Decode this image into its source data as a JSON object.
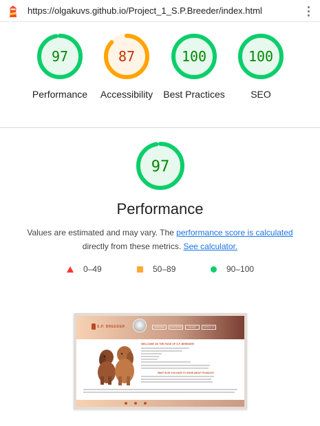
{
  "url_bar": {
    "url": "https://olgakuvs.github.io/Project_1_S.P.Breeder/index.html",
    "logo_icon": "lighthouse-icon",
    "menu_icon": "kebab-menu-icon"
  },
  "gauges": [
    {
      "label": "Performance",
      "score": "97",
      "fraction": 0.97,
      "color": "#0cce6b",
      "fill": "#e7f8ee",
      "text_color": "#008800"
    },
    {
      "label": "Accessibility",
      "score": "87",
      "fraction": 0.87,
      "color": "#ffa400",
      "fill": "#fff4e5",
      "text_color": "#c33300"
    },
    {
      "label": "Best Practices",
      "score": "100",
      "fraction": 1.0,
      "color": "#0cce6b",
      "fill": "#e7f8ee",
      "text_color": "#008800"
    },
    {
      "label": "SEO",
      "score": "100",
      "fraction": 1.0,
      "color": "#0cce6b",
      "fill": "#e7f8ee",
      "text_color": "#008800"
    }
  ],
  "performance": {
    "score": "97",
    "fraction": 0.97,
    "title": "Performance",
    "desc_prefix": "Values are estimated and may vary. The ",
    "link_score": "performance score is calculated",
    "desc_middle": " directly from these metrics. ",
    "link_calc": "See calculator."
  },
  "legend": [
    {
      "icon": "fail-triangle-icon",
      "range": "0–49",
      "color": "#ff3333"
    },
    {
      "icon": "average-square-icon",
      "range": "50–89",
      "color": "#ffaa33"
    },
    {
      "icon": "pass-circle-icon",
      "range": "90–100",
      "color": "#0cce6b"
    }
  ],
  "screenshot": {
    "brand": "S.P. BREEDER",
    "nav": [
      "HOME PAGE",
      "OUR PUPPIES",
      "GALLERY",
      "CONTACT US"
    ],
    "welcome": "WELCOME ON THE PAGE OF S.P. BREEDER!",
    "subheading": "WHAT ELSE YOU HAVE TO KNOW ABOUT POODLES?"
  }
}
